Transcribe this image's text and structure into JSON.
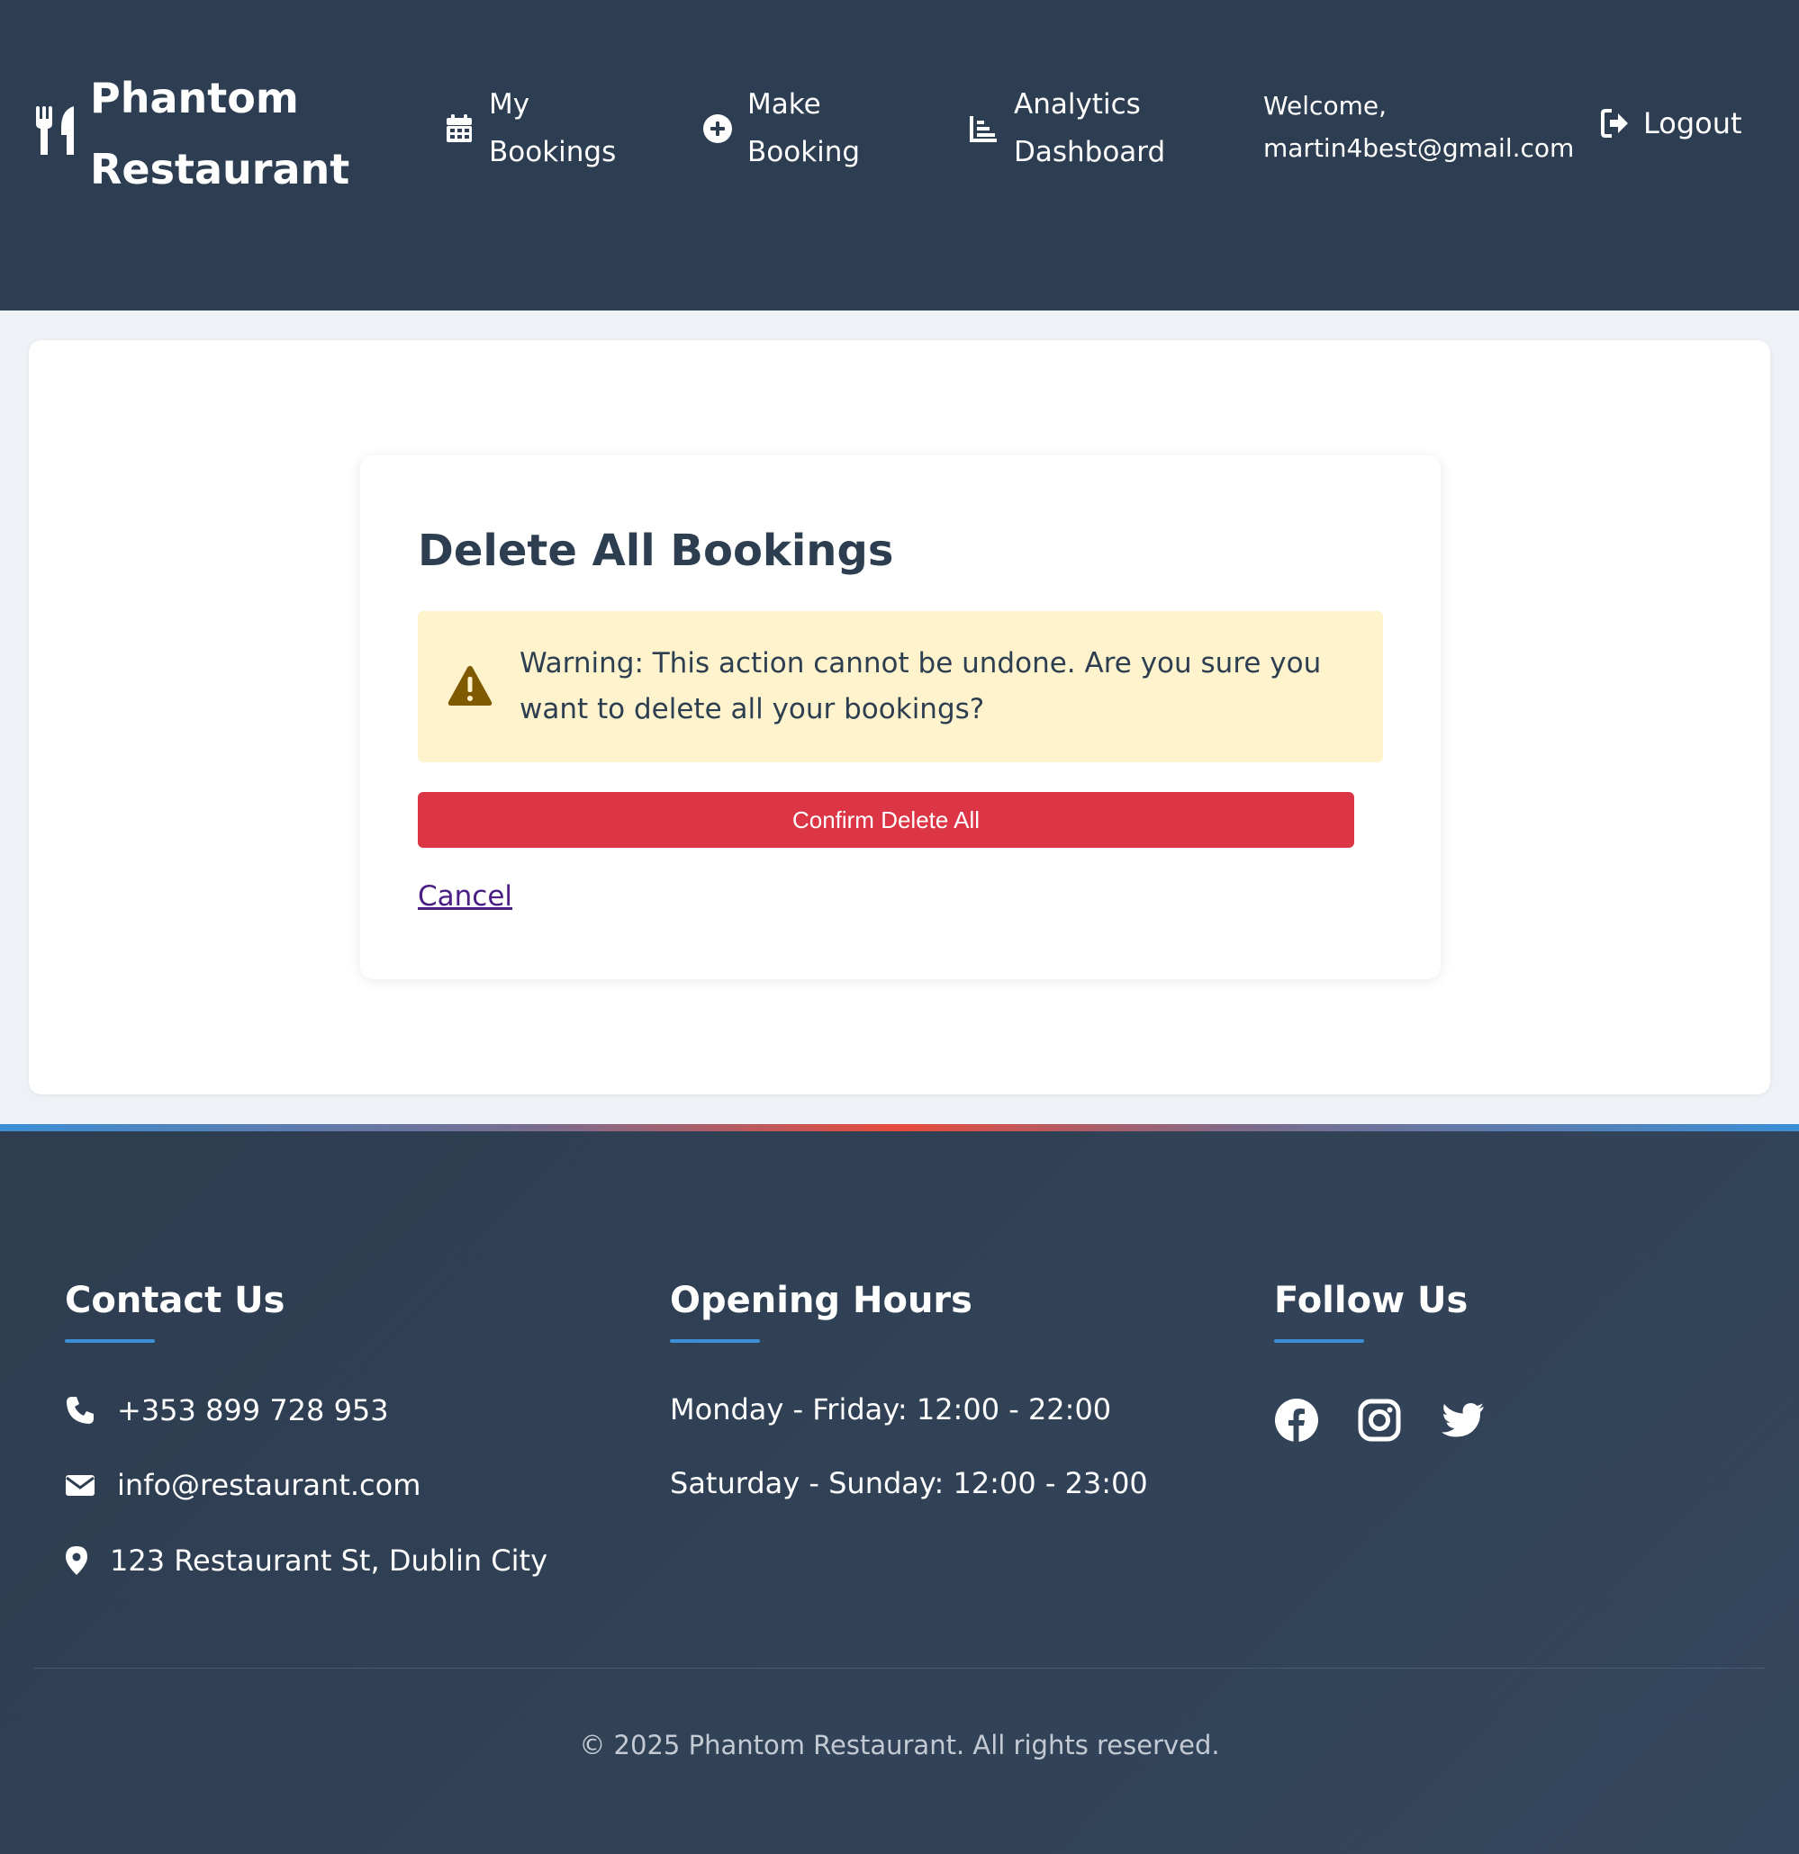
{
  "brand": {
    "name_line1": "Phantom",
    "name_line2": "Restaurant",
    "icon": "utensils-icon"
  },
  "nav": {
    "my_bookings": {
      "line1": "My",
      "line2": "Bookings",
      "icon": "calendar-icon"
    },
    "make_booking": {
      "line1": "Make",
      "line2": "Booking",
      "icon": "plus-circle-icon"
    },
    "analytics": {
      "line1": "Analytics",
      "line2": "Dashboard",
      "icon": "chart-bar-icon"
    }
  },
  "user": {
    "welcome_label": "Welcome,",
    "email": "martin4best@gmail.com"
  },
  "logout": {
    "label": "Logout",
    "icon": "sign-out-icon"
  },
  "dialog": {
    "title": "Delete All Bookings",
    "warning_text": "Warning: This action cannot be undone. Are you sure you want to delete all your bookings?",
    "warning_icon": "warning-triangle-icon",
    "confirm_label": "Confirm Delete All",
    "cancel_label": "Cancel"
  },
  "footer": {
    "contact": {
      "heading": "Contact Us",
      "phone": "+353 899 728 953",
      "email": "info@restaurant.com",
      "address": "123 Restaurant St, Dublin City"
    },
    "hours": {
      "heading": "Opening Hours",
      "weekdays": "Monday - Friday: 12:00 - 22:00",
      "weekend": "Saturday - Sunday: 12:00 - 23:00"
    },
    "follow": {
      "heading": "Follow Us",
      "networks": [
        "facebook-icon",
        "instagram-icon",
        "twitter-icon"
      ]
    },
    "copyright": "© 2025 Phantom Restaurant. All rights reserved."
  },
  "colors": {
    "header_bg": "#2e3e52",
    "danger": "#dc3545",
    "warning_bg": "#fef3cd",
    "warning_icon": "#7f5a00",
    "accent": "#3a8fd6"
  }
}
